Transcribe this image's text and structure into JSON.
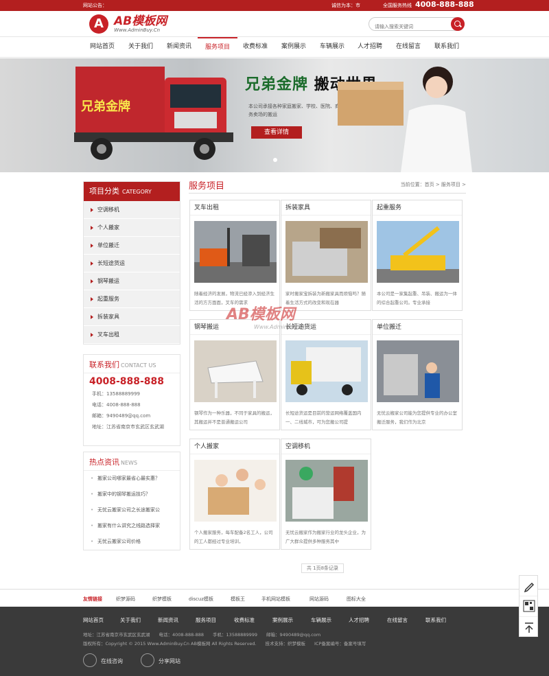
{
  "topbar": {
    "notice_label": "网站公告：",
    "welcome": "诚信为本：市",
    "hotline_label": "全国服务热线",
    "hotline": "4008-888-888"
  },
  "logo": {
    "mark": "A",
    "name": "AB模板网",
    "sub": "Www.AdminBuy.Cn"
  },
  "search": {
    "placeholder": "请输入搜索关键词"
  },
  "nav": [
    "网站首页",
    "关于我们",
    "新闻资讯",
    "服务项目",
    "收费标准",
    "案例展示",
    "车辆展示",
    "人才招聘",
    "在线留言",
    "联系我们"
  ],
  "banner": {
    "truck_text": "兄弟金牌",
    "slogan_a": "兄弟金牌",
    "slogan_b": "搬动世界",
    "desc": "本公司承接各种家庭搬家、学校、医院、商务楼的搬迁及各大商务卖场的搬运",
    "button": "查看详情"
  },
  "sidebar": {
    "cat_title": "项目分类",
    "cat_sub": "CATEGORY",
    "categories": [
      "空调移机",
      "个人搬家",
      "单位搬迁",
      "长短途货运",
      "钢琴搬运",
      "起重服务",
      "拆装家具",
      "叉车出租"
    ],
    "contact_title": "联系我们",
    "contact_sub": "CONTACT US",
    "phone": "4008-888-888",
    "contacts": [
      "手机：13588889999",
      "电话：4008-888-888",
      "邮箱：9490489@qq.com",
      "地址：江苏省南京市玄武区玄武湖"
    ],
    "news_title": "热点资讯",
    "news_sub": "NEWS",
    "news": [
      "搬家公司哪家最省心最实惠？",
      "搬家中的钢琴搬运技巧？",
      "无忧云搬家公司之长途搬家公",
      "搬家有什么讲究之线路选择家",
      "无忧云搬家公司价格"
    ]
  },
  "main": {
    "title": "服务项目",
    "breadcrumb": "当前位置：首页 > 服务项目 >",
    "cards": [
      {
        "title": "叉车出租",
        "desc": "随着经济的发展，物流已经渗入到经济生活的方方面面，叉车的需求"
      },
      {
        "title": "拆装家具",
        "desc": "家时搬家宝拆装为新搬家具而烦恼吗？随着生活方式的改变和现在器"
      },
      {
        "title": "起重服务",
        "desc": "本公司是一家集起重、吊装、搬运为一体的综合起重公司。专业承接"
      },
      {
        "title": "钢琴搬运",
        "desc": "钢琴作为一种乐器，不同于家具的搬运，其搬运并不是普通搬运公司"
      },
      {
        "title": "长短途货运",
        "desc": "长短途货运是目前的营运网络覆盖国内一、二线城市，可为您搬公司提"
      },
      {
        "title": "单位搬迁",
        "desc": "无忧云搬家公司能为您提供专业的办公室搬迁服务，我们作为北京"
      },
      {
        "title": "个人搬家",
        "desc": "个人搬家服务，每车配备2名工人，公司的工人都经过专业培训，"
      },
      {
        "title": "空调移机",
        "desc": "无忧云搬家作为搬家行业的龙头企业，为广大群众提供多种服务其中"
      }
    ],
    "pager": "共 1页8条记录"
  },
  "watermark": {
    "name": "AB模板网",
    "url": "Www.AdminBuy.Cn"
  },
  "links": {
    "label": "友情链接",
    "items": [
      "织梦源码",
      "织梦模板",
      "discuz模板",
      "模板王",
      "手机网站模板",
      "网站源码",
      "图标大全"
    ]
  },
  "footer": {
    "nav": [
      "网站首页",
      "关于我们",
      "新闻资讯",
      "服务项目",
      "收费标准",
      "案例展示",
      "车辆展示",
      "人才招聘",
      "在线留言",
      "联系我们"
    ],
    "line1": "地址：江苏省南京市玄武区玄武湖　　电话：4008-888-888　　手机：13588889999　　邮箱：9490489@qq.com",
    "line2": "版权所有：Copyright © 2015 Www.AdminBuy.Cn AB模板网 All Rights Reserved.　　技术支持：织梦模板　　ICP备案编号：备案号填写",
    "social": [
      "在线咨询",
      "分享网站"
    ]
  },
  "colors": {
    "brand": "#b31f1f",
    "accent": "#c82127",
    "footer": "#3a3a3a"
  }
}
